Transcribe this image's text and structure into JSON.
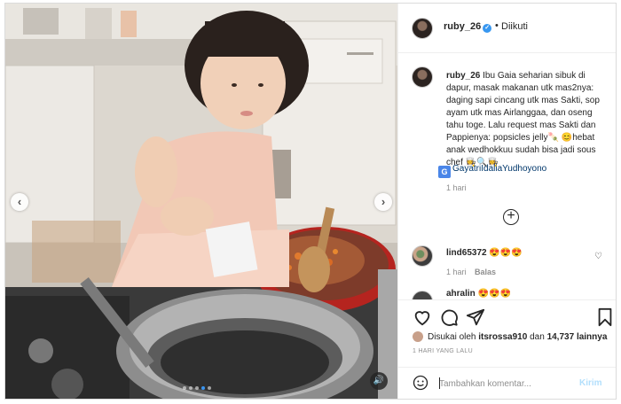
{
  "post": {
    "username": "ruby_26",
    "verified_mark": "✓",
    "separator": "•",
    "follow_status": "Diikuti"
  },
  "caption": {
    "username": "ruby_26",
    "text": "Ibu Gaia seharian sibuk di dapur, masak makanan utk mas2nya: daging sapi cincang utk mas Sakti, sop ayam utk mas Airlanggaa, dan oseng tahu toge. Lalu request mas Sakti dan Pappienya: popsicles jelly🍡 😊hebat anak wedhokkuu sudah bisa jadi sous chef 👩‍🍳🔍👩‍🍳",
    "translate_icon_label": "G",
    "mention": "GayatriIdaliaYudhoyono",
    "time": "1 hari"
  },
  "load_more_icon": "plus-circle-icon",
  "comments": [
    {
      "username": "lind65372",
      "text": "😍😍😍",
      "time": "1 hari",
      "reply_label": "Balas",
      "like_icon": "♡"
    },
    {
      "username": "ahralin",
      "text": "😍😍😍"
    }
  ],
  "actions": {
    "like_icon": "heart-icon",
    "comment_icon": "comment-icon",
    "share_icon": "send-icon",
    "save_icon": "bookmark-icon"
  },
  "likes": {
    "prefix": "Disukai oleh",
    "user": "itsrossa910",
    "joiner": "dan",
    "count": "14,737",
    "suffix": "lainnya"
  },
  "time_ago": "1 HARI YANG LALU",
  "comment_box": {
    "placeholder": "Tambahkan komentar...",
    "send_label": "Kirim"
  },
  "media": {
    "prev_glyph": "‹",
    "next_glyph": "›",
    "sound_glyph": "🔊",
    "slide_count": 5,
    "active_slide": 3
  }
}
